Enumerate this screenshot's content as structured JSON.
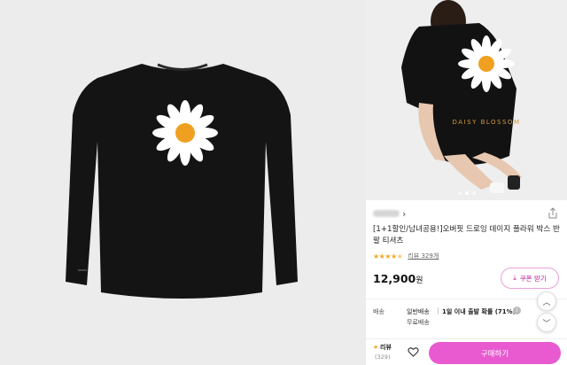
{
  "product": {
    "title": "[1+1할인/남녀공용!]오버핏 드로잉 데이지 플라워 박스 반팔 티셔츠",
    "rating_stars": "★★★★",
    "rating_half_star": "★",
    "review_link": "리뷰 329개",
    "price": "12,900",
    "price_unit": "원",
    "print_text": "DAISY BLOSSOM",
    "image_count": 3,
    "current_image_index": 2
  },
  "store": {
    "chevron": "›"
  },
  "coupon": {
    "label": "쿠폰 받기",
    "icon": "download-icon",
    "icon_glyph": "⤓"
  },
  "shipping": {
    "label": "배송",
    "type": "일반배송",
    "description": "1일 이내 출발 확률 (71%)",
    "info_glyph": "i",
    "free": "무료배송"
  },
  "nav": {
    "up_glyph": "︿",
    "down_glyph": "﹀"
  },
  "bottom": {
    "review_star": "★",
    "review_label": "리뷰",
    "review_count": "(329)",
    "buy_label": "구매하기"
  },
  "colors": {
    "accent": "#e95ad0",
    "coupon_text": "#c2179f",
    "star": "#f5a623",
    "shirt": "#111111",
    "daisy_center": "#f0a020"
  }
}
